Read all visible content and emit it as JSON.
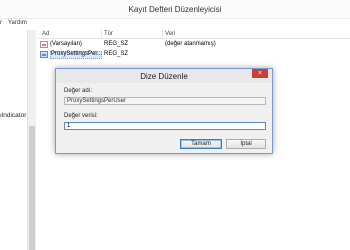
{
  "window": {
    "title": "Kayıt Defteri Düzenleyicisi"
  },
  "menu": [
    {
      "label": "r"
    },
    {
      "label": "Yardım"
    }
  ],
  "tree": {
    "partial_text": "ılndicator"
  },
  "list": {
    "headers": {
      "name": "Ad",
      "type": "Tür",
      "data": "Veri"
    },
    "rows": [
      {
        "icon": "string-value-icon",
        "name": "(Varsayılan)",
        "type": "REG_SZ",
        "data": "(değer atanmamış)"
      },
      {
        "icon": "string-value-icon",
        "name": "ProxySettingsPer...",
        "type": "REG_SZ",
        "data": ""
      }
    ]
  },
  "dialog": {
    "title": "Dize Düzenle",
    "close_glyph": "×",
    "value_name_label": "Değer adı:",
    "value_name": "ProxySettingsPerUser",
    "value_data_label": "Değer verisi:",
    "value_data": "1",
    "ok_label": "Tamam",
    "cancel_label": "İptal"
  },
  "colors": {
    "close_button": "#c7413a",
    "selection": "#d9e8fb",
    "accent_border": "#7a9ad6"
  }
}
